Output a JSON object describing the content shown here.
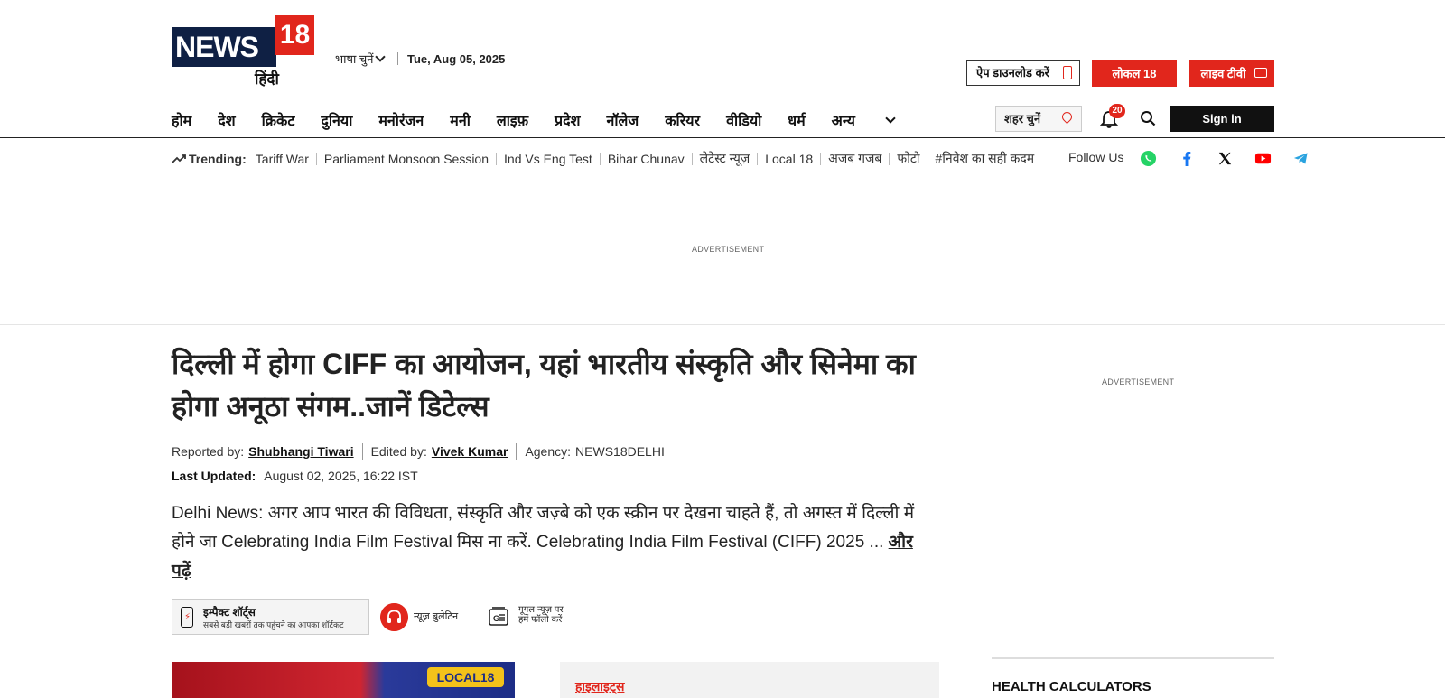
{
  "brand": {
    "logo_main": "NEWS",
    "logo_num": "18",
    "logo_lang": "हिंदी",
    "color_brand": "#e1261c",
    "color_navy": "#0f2044"
  },
  "header": {
    "language_select": "भाषा चुनें",
    "date": "Tue, Aug 05, 2025",
    "app_download": "ऐप डाउनलोड करें",
    "local": "लोकल 18",
    "live_tv": "लाइव टीवी",
    "city_select": "शहर चुनें",
    "notification_count": "20",
    "signin": "Sign in"
  },
  "nav": {
    "items": [
      "होम",
      "देश",
      "क्रिकेट",
      "दुनिया",
      "मनोरंजन",
      "मनी",
      "लाइफ़",
      "प्रदेश",
      "नॉलेज",
      "करियर",
      "वीडियो",
      "धर्म",
      "अन्य"
    ]
  },
  "trending": {
    "label": "Trending:",
    "items": [
      "Tariff War",
      "Parliament Monsoon Session",
      "Ind Vs Eng Test",
      "Bihar Chunav",
      "लेटेस्ट न्यूज़",
      "Local 18",
      "अजब गजब",
      "फोटो",
      "#निवेश का सही कदम"
    ],
    "follow_label": "Follow Us",
    "social_icons": [
      "whatsapp-icon",
      "facebook-icon",
      "x-icon",
      "youtube-icon",
      "telegram-icon"
    ]
  },
  "ads": {
    "label": "ADVERTISEMENT"
  },
  "article": {
    "headline": "दिल्ली में होगा CIFF का आयोजन, यहां भारतीय संस्कृति और सिनेमा का होगा अनूठा संगम..जानें डिटेल्स",
    "reported_label": "Reported by:",
    "reporter": "Shubhangi Tiwari",
    "edited_label": "Edited by:",
    "editor": "Vivek Kumar",
    "agency_label": "Agency:",
    "agency": "NEWS18DELHI",
    "updated_label": "Last Updated:",
    "updated_value": "August 02, 2025, 16:22 IST",
    "summary": "Delhi News: अगर आप भारत की विविधता, संस्कृति और जज़्बे को एक स्क्रीन पर देखना चाहते हैं, तो अगस्त में दिल्ली में होने जा Celebrating India Film Festival मिस ना करें. Celebrating India Film Festival (CIFF) 2025 ... ",
    "read_more": "और पढ़ें",
    "shorts_title": "इम्पैक्ट शॉर्ट्स",
    "shorts_sub": "सबसे बड़ी खबरों तक पहुंचने का आपका शॉर्टकट",
    "bulletin": "न्यूज़ बुलेटिन",
    "gnews_line1": "गूगल न्यूज़ पर",
    "gnews_line2": "हमें फॉलो करें",
    "hero_badge": "LOCAL18",
    "highlights": "हाइलाइट्स"
  },
  "sidebar": {
    "health_title": "HEALTH CALCULATORS"
  }
}
